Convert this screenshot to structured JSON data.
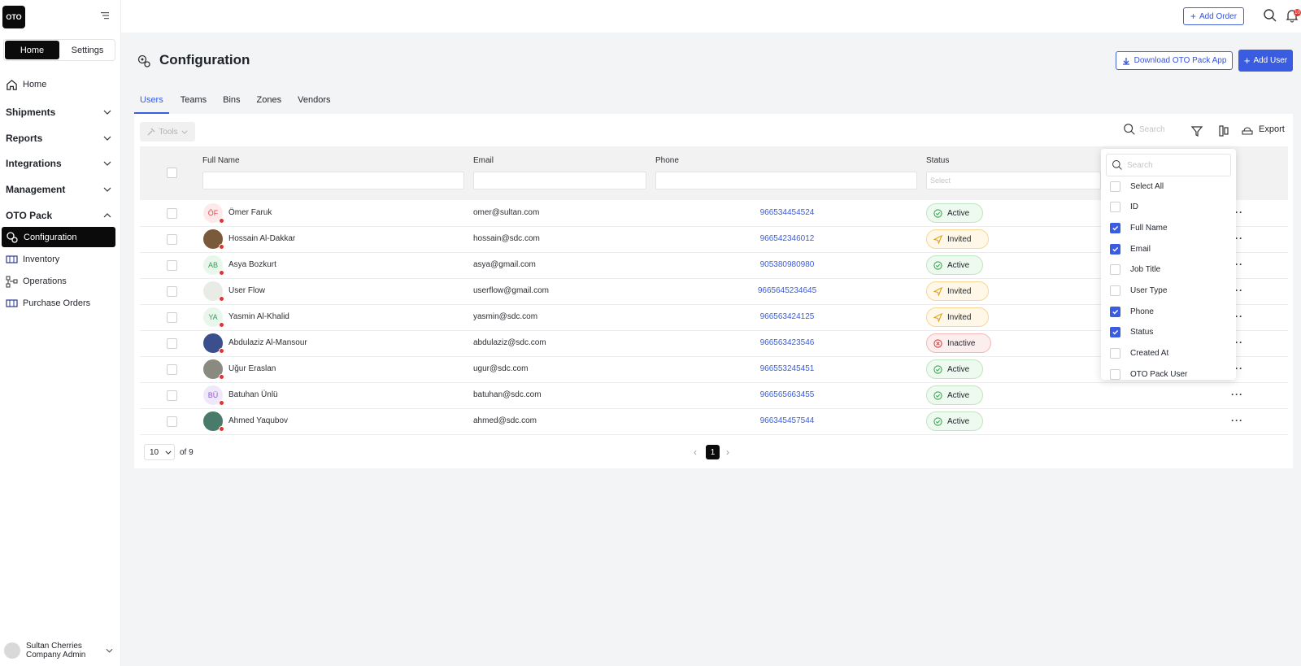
{
  "brand": {
    "logo_text": "OTO",
    "accent": "#3a5ce0"
  },
  "sidebar": {
    "segments": [
      "Home",
      "Settings"
    ],
    "home_label": "Home",
    "groups": [
      "Shipments",
      "Reports",
      "Integrations",
      "Management",
      "OTO Pack"
    ],
    "sub_items": [
      "Configuration",
      "Inventory",
      "Operations",
      "Purchase Orders"
    ],
    "user": {
      "name": "Sultan Cherries",
      "role": "Company Admin"
    }
  },
  "topbar": {
    "add_order": "Add Order",
    "notif_count": "10"
  },
  "page": {
    "title": "Configuration",
    "download_btn": "Download OTO Pack App",
    "add_user_btn": "Add User"
  },
  "tabs": [
    "Users",
    "Teams",
    "Bins",
    "Zones",
    "Vendors"
  ],
  "toolbar": {
    "tools": "Tools",
    "search_placeholder": "Search",
    "export": "Export"
  },
  "table": {
    "headers": {
      "full_name": "Full Name",
      "email": "Email",
      "phone": "Phone",
      "status": "Status"
    },
    "status_placeholder": "Select",
    "rows": [
      {
        "initials": "ÖF",
        "name": "Ömer Faruk",
        "email": "omer@sultan.com",
        "phone": "966534454524",
        "status": "Active"
      },
      {
        "initials": "",
        "name": "Hossain Al-Dakkar",
        "email": "hossain@sdc.com",
        "phone": "966542346012",
        "status": "Invited"
      },
      {
        "initials": "AB",
        "name": "Asya Bozkurt",
        "email": "asya@gmail.com",
        "phone": "905380980980",
        "status": "Active"
      },
      {
        "initials": "",
        "name": "User Flow",
        "email": "userflow@gmail.com",
        "phone": "9665645234645",
        "status": "Invited"
      },
      {
        "initials": "YA",
        "name": "Yasmin Al-Khalid",
        "email": "yasmin@sdc.com",
        "phone": "966563424125",
        "status": "Invited"
      },
      {
        "initials": "",
        "name": "Abdulaziz Al-Mansour",
        "email": "abdulaziz@sdc.com",
        "phone": "966563423546",
        "status": "Inactive"
      },
      {
        "initials": "",
        "name": "Uğur Eraslan",
        "email": "ugur@sdc.com",
        "phone": "966553245451",
        "status": "Active"
      },
      {
        "initials": "BÜ",
        "name": "Batuhan Ünlü",
        "email": "batuhan@sdc.com",
        "phone": "966565663455",
        "status": "Active"
      },
      {
        "initials": "",
        "name": "Ahmed Yaqubov",
        "email": "ahmed@sdc.com",
        "phone": "966345457544",
        "status": "Active"
      }
    ]
  },
  "pagination": {
    "page_size": "10",
    "of_label": "of 9",
    "current_page": "1"
  },
  "column_menu": {
    "search_placeholder": "Search",
    "items": [
      {
        "label": "Select All",
        "checked": false
      },
      {
        "label": "ID",
        "checked": false
      },
      {
        "label": "Full Name",
        "checked": true
      },
      {
        "label": "Email",
        "checked": true
      },
      {
        "label": "Job Title",
        "checked": false
      },
      {
        "label": "User Type",
        "checked": false
      },
      {
        "label": "Phone",
        "checked": true
      },
      {
        "label": "Status",
        "checked": true
      },
      {
        "label": "Created At",
        "checked": false
      },
      {
        "label": "OTO Pack User",
        "checked": false
      }
    ]
  }
}
